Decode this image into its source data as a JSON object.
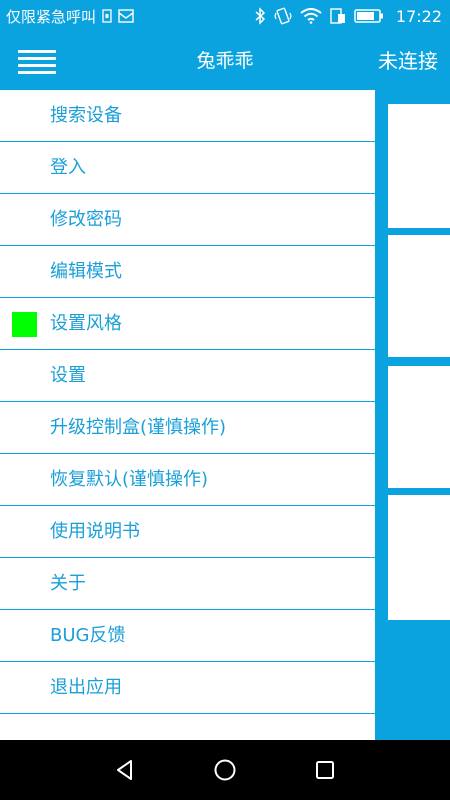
{
  "status_bar": {
    "carrier_text": "仅限紧急呼叫",
    "time": "17:22",
    "icons": [
      "sim-icon",
      "message-icon",
      "bluetooth-icon",
      "vibrate-icon",
      "wifi-icon",
      "data-sim-icon",
      "battery-icon"
    ]
  },
  "app_bar": {
    "title": "兔乖乖",
    "connection_status": "未连接",
    "menu_icon": "hamburger-menu-icon"
  },
  "drawer": {
    "items": [
      {
        "label": "搜索设备"
      },
      {
        "label": "登入"
      },
      {
        "label": "修改密码"
      },
      {
        "label": "编辑模式"
      },
      {
        "label": "设置风格",
        "swatch_color": "#00ff00"
      },
      {
        "label": "设置"
      },
      {
        "label": "升级控制盒(谨慎操作)"
      },
      {
        "label": "恢复默认(谨慎操作)"
      },
      {
        "label": "使用说明书"
      },
      {
        "label": "关于"
      },
      {
        "label": "BUG反馈"
      },
      {
        "label": "退出应用"
      }
    ]
  },
  "nav_bar": {
    "icons": [
      "back-icon",
      "home-icon",
      "recents-icon"
    ]
  },
  "colors": {
    "primary": "#0aa3e0",
    "menu_text": "#1a9fd8",
    "swatch": "#00ff00"
  }
}
